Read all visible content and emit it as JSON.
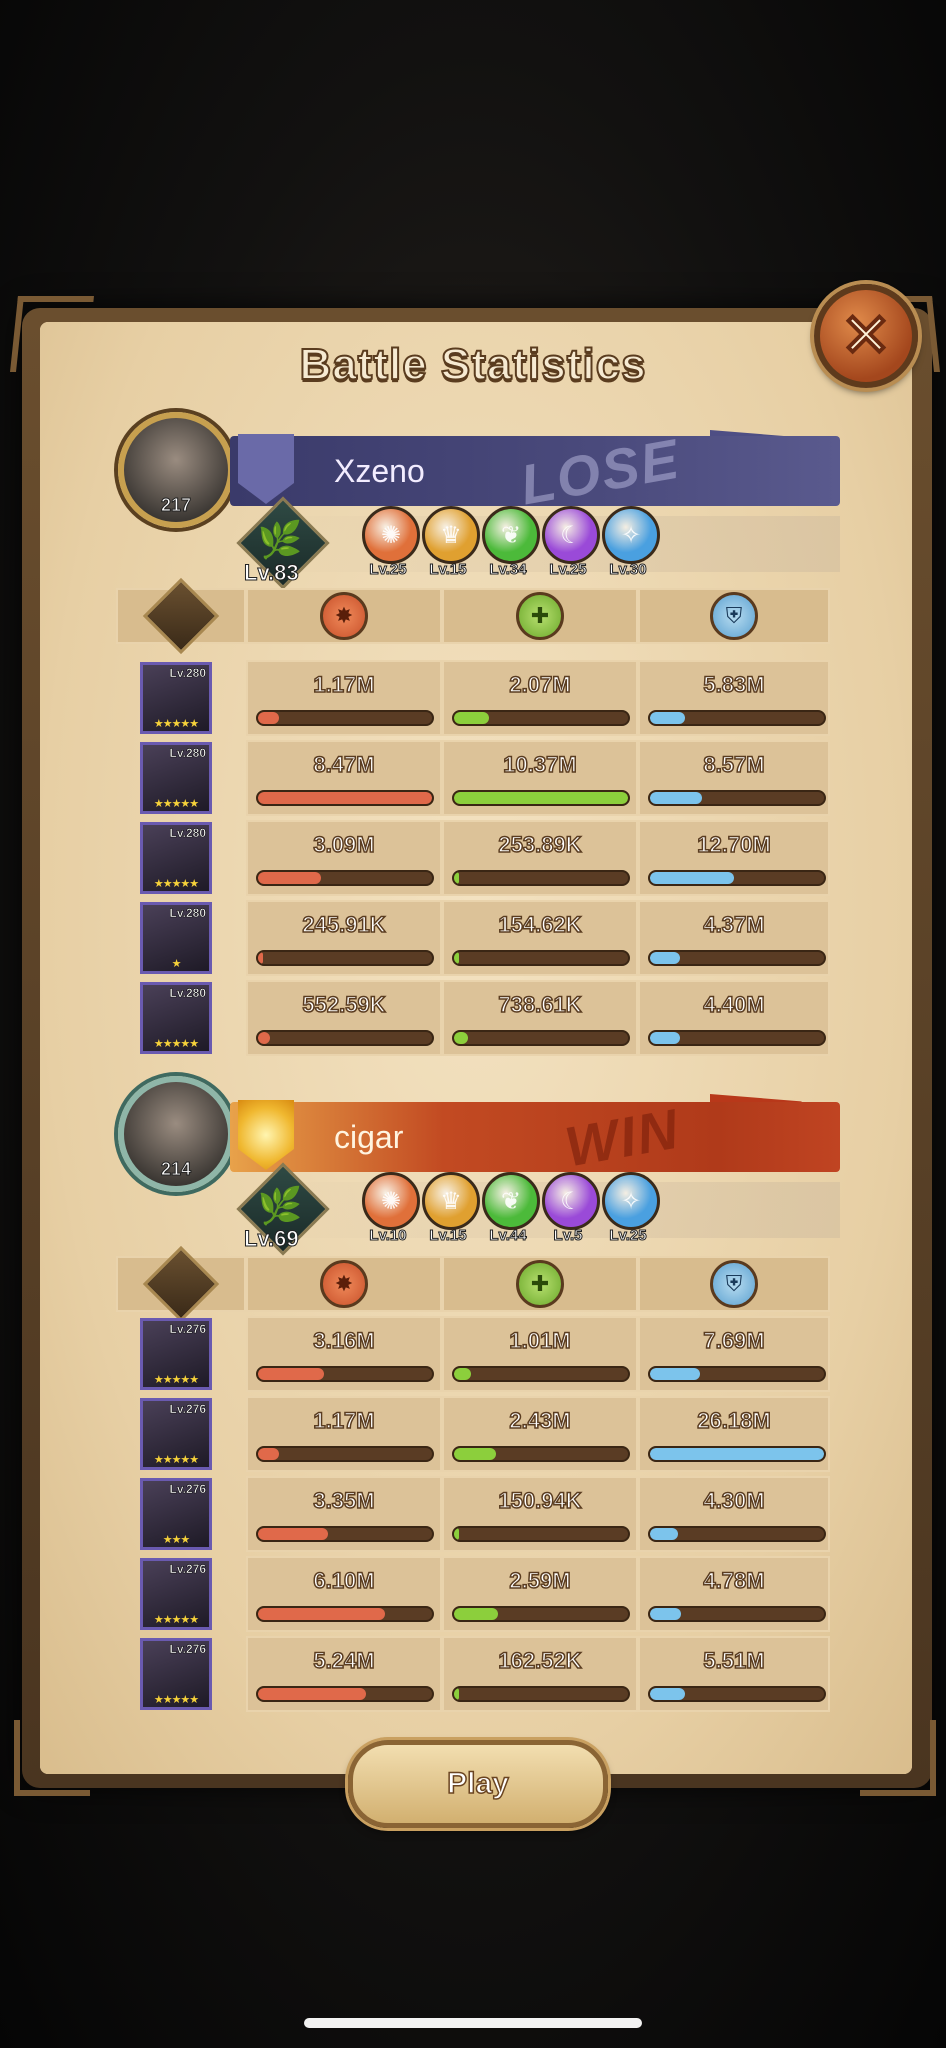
{
  "title": "Battle Statistics",
  "close_icon": "close-x-icon",
  "play_label": "Play",
  "colors": {
    "damage": "#e0694a",
    "healing": "#8ccf3c",
    "tank": "#7cc4ec",
    "lose_banner": "#4a4a7c",
    "win_banner": "#c24a22"
  },
  "teams": [
    {
      "player_name": "Xzeno",
      "avatar_level": "217",
      "result": "LOSE",
      "level": "Lv.83",
      "factions": [
        {
          "icon": "lightbearer-icon",
          "color": "#e0703a",
          "level": "Lv.25"
        },
        {
          "icon": "mauler-icon",
          "color": "#e0a030",
          "level": "Lv.15"
        },
        {
          "icon": "wilder-icon",
          "color": "#4cba3a",
          "level": "Lv.34"
        },
        {
          "icon": "graveborn-icon",
          "color": "#9a4ad8",
          "level": "Lv.25"
        },
        {
          "icon": "celestial-icon",
          "color": "#4aa0e0",
          "level": "Lv.30"
        }
      ],
      "heroes": [
        {
          "level": "Lv.280",
          "stars": "★★★★★",
          "damage": "1.17M",
          "damage_pct": 0.12,
          "healing": "2.07M",
          "healing_pct": 0.2,
          "tank": "5.83M",
          "tank_pct": 0.2
        },
        {
          "level": "Lv.280",
          "stars": "★★★★★",
          "damage": "8.47M",
          "damage_pct": 1.0,
          "healing": "10.37M",
          "healing_pct": 1.0,
          "tank": "8.57M",
          "tank_pct": 0.3
        },
        {
          "level": "Lv.280",
          "stars": "★★★★★",
          "damage": "3.09M",
          "damage_pct": 0.36,
          "healing": "253.89K",
          "healing_pct": 0.03,
          "tank": "12.70M",
          "tank_pct": 0.48
        },
        {
          "level": "Lv.280",
          "stars": "★",
          "damage": "245.91K",
          "damage_pct": 0.03,
          "healing": "154.62K",
          "healing_pct": 0.02,
          "tank": "4.37M",
          "tank_pct": 0.17
        },
        {
          "level": "Lv.280",
          "stars": "★★★★★",
          "damage": "552.59K",
          "damage_pct": 0.07,
          "healing": "738.61K",
          "healing_pct": 0.08,
          "tank": "4.40M",
          "tank_pct": 0.17
        }
      ]
    },
    {
      "player_name": "cigar",
      "avatar_level": "214",
      "result": "WIN",
      "level": "Lv.69",
      "factions": [
        {
          "icon": "lightbearer-icon",
          "color": "#e0703a",
          "level": "Lv.10"
        },
        {
          "icon": "mauler-icon",
          "color": "#e0a030",
          "level": "Lv.15"
        },
        {
          "icon": "wilder-icon",
          "color": "#4cba3a",
          "level": "Lv.44"
        },
        {
          "icon": "graveborn-icon",
          "color": "#9a4ad8",
          "level": "Lv.5"
        },
        {
          "icon": "celestial-icon",
          "color": "#4aa0e0",
          "level": "Lv.25"
        }
      ],
      "heroes": [
        {
          "level": "Lv.276",
          "stars": "★★★★★",
          "damage": "3.16M",
          "damage_pct": 0.38,
          "healing": "1.01M",
          "healing_pct": 0.1,
          "tank": "7.69M",
          "tank_pct": 0.29
        },
        {
          "level": "Lv.276",
          "stars": "★★★★★",
          "damage": "1.17M",
          "damage_pct": 0.12,
          "healing": "2.43M",
          "healing_pct": 0.24,
          "tank": "26.18M",
          "tank_pct": 1.0
        },
        {
          "level": "Lv.276",
          "stars": "★★★",
          "damage": "3.35M",
          "damage_pct": 0.4,
          "healing": "150.94K",
          "healing_pct": 0.02,
          "tank": "4.30M",
          "tank_pct": 0.16
        },
        {
          "level": "Lv.276",
          "stars": "★★★★★",
          "damage": "6.10M",
          "damage_pct": 0.73,
          "healing": "2.59M",
          "healing_pct": 0.25,
          "tank": "4.78M",
          "tank_pct": 0.18
        },
        {
          "level": "Lv.276",
          "stars": "★★★★★",
          "damage": "5.24M",
          "damage_pct": 0.62,
          "healing": "162.52K",
          "healing_pct": 0.02,
          "tank": "5.51M",
          "tank_pct": 0.2
        }
      ]
    }
  ]
}
